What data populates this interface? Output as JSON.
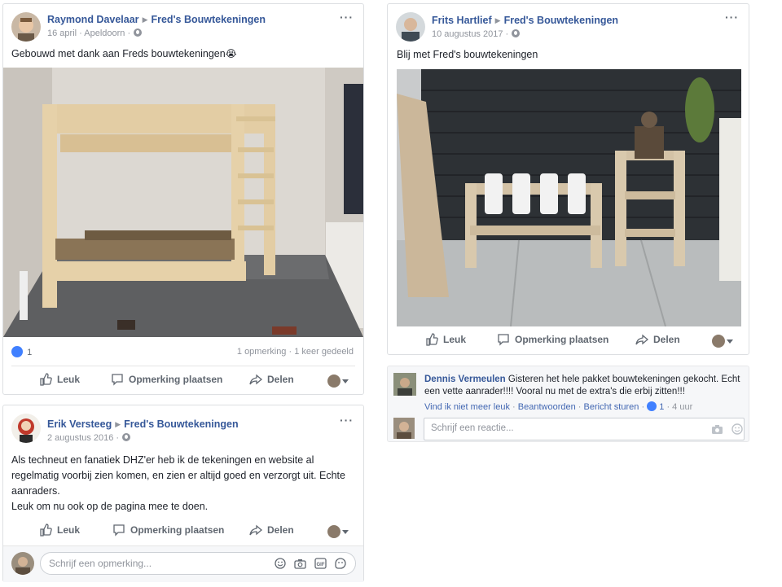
{
  "post1": {
    "author": "Raymond Davelaar",
    "page": "Fred's Bouwtekeningen",
    "date": "16 april",
    "place": "Apeldoorn",
    "text": "Gebouwd met dank aan Freds bouwtekeningen",
    "emoji": "😭",
    "reaction_count": "1",
    "comments_count": "1 opmerking",
    "shares_count": "1 keer gedeeld",
    "like_label": "Leuk",
    "comment_label": "Opmerking plaatsen",
    "share_label": "Delen",
    "dots": "···"
  },
  "post2": {
    "author": "Frits Hartlief",
    "page": "Fred's Bouwtekeningen",
    "date": "10 augustus 2017",
    "text": "Blij met Fred's bouwtekeningen",
    "like_label": "Leuk",
    "comment_label": "Opmerking plaatsen",
    "share_label": "Delen",
    "dots": "···"
  },
  "comment2": {
    "author": "Dennis Vermeulen",
    "text_line1": "Gisteren het hele pakket bouwtekeningen gekocht. Echt",
    "text_line2": "een vette aanrader!!!! Vooral nu met de extra's die erbij zitten!!!",
    "action_like": "Vind ik niet meer leuk",
    "action_reply": "Beantwoorden",
    "action_message": "Bericht sturen",
    "like_count": "1",
    "time": "4 uur",
    "reply_placeholder": "Schrijf een reactie..."
  },
  "post3": {
    "author": "Erik Versteeg",
    "page": "Fred's Bouwtekeningen",
    "date": "2 augustus 2016",
    "text_line1": "Als techneut en fanatiek DHZ'er heb ik de tekeningen en website al",
    "text_line2": "regelmatig voorbij zien komen, en zien er altijd goed en verzorgt uit. Echte",
    "text_line3": "aanraders.",
    "text_line4": "Leuk om nu ook op de pagina mee te doen.",
    "like_label": "Leuk",
    "comment_label": "Opmerking plaatsen",
    "share_label": "Delen",
    "comment_placeholder": "Schrijf een opmerking...",
    "dots": "···"
  },
  "colors": {
    "link": "#365899",
    "meta": "#90949c",
    "action": "#606770",
    "like_blue": "#4080ff"
  }
}
